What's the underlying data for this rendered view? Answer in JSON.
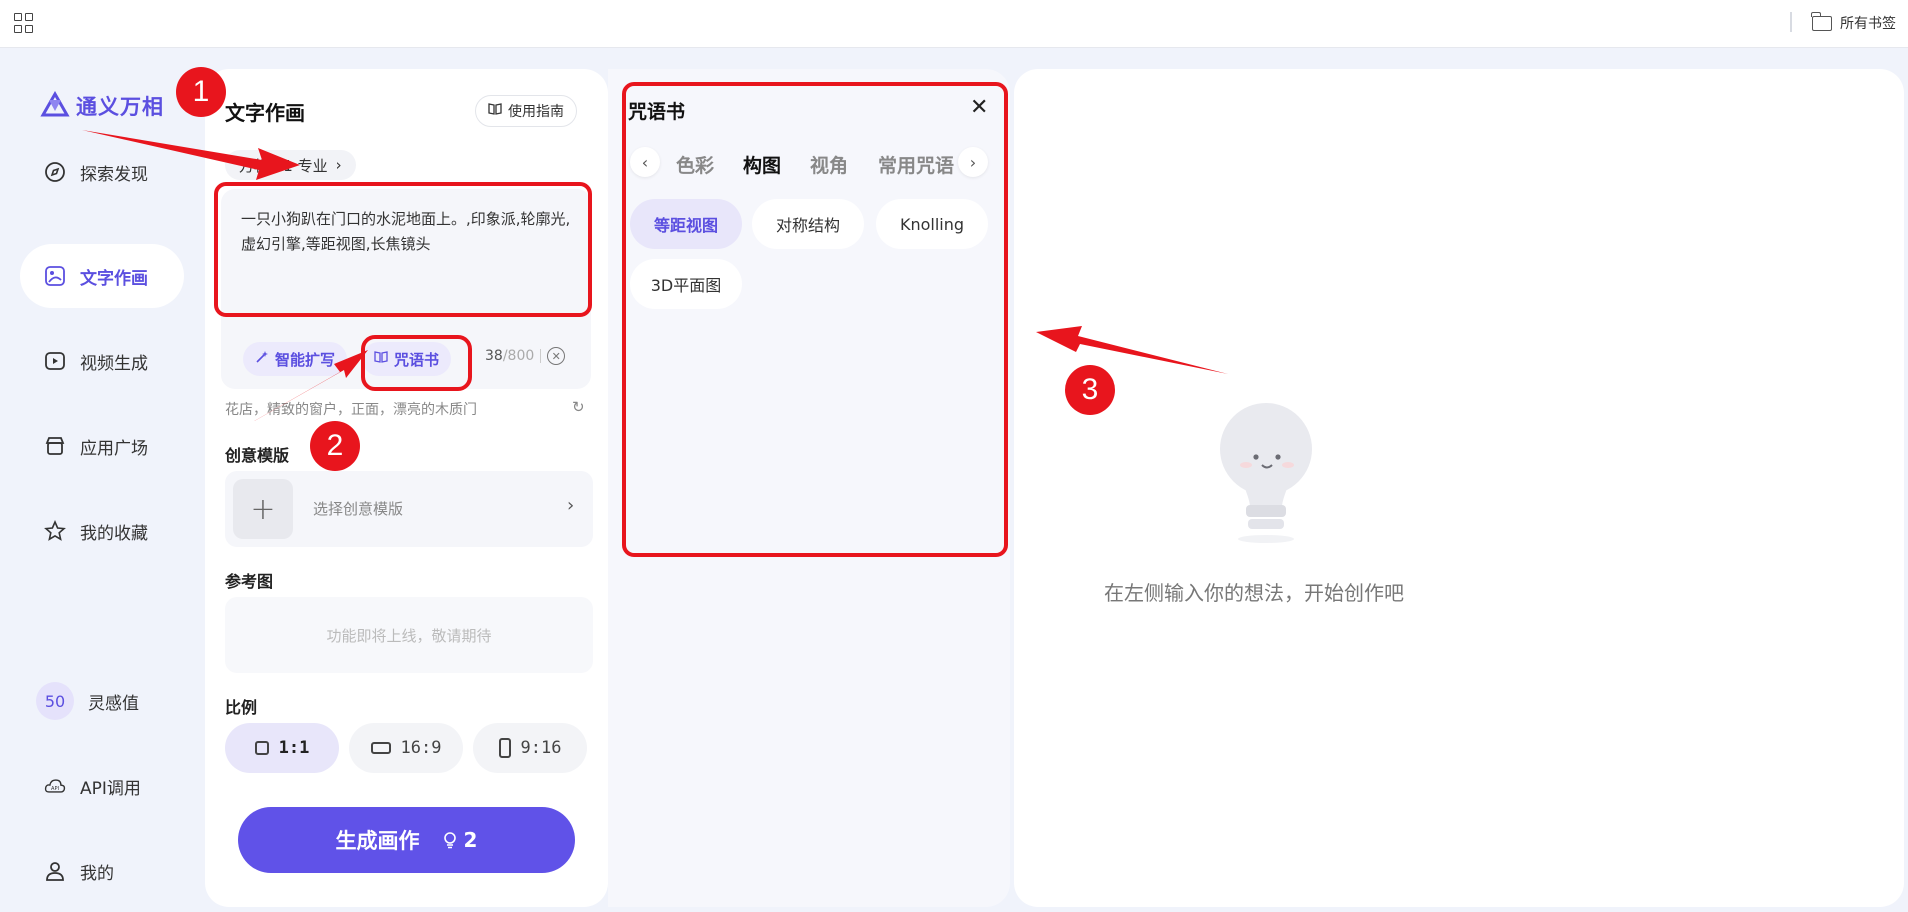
{
  "topbar": {
    "bookmarks_label": "所有书签"
  },
  "sidebar": {
    "logo_text": "通义万相",
    "items": [
      {
        "label": "探索发现",
        "icon": "compass-icon"
      },
      {
        "label": "文字作画",
        "icon": "image-icon"
      },
      {
        "label": "视频生成",
        "icon": "video-icon"
      },
      {
        "label": "应用广场",
        "icon": "store-icon"
      },
      {
        "label": "我的收藏",
        "icon": "star-icon"
      }
    ],
    "inspiration_value": "50",
    "inspiration_label": "灵感值",
    "api_label": "API调用",
    "me_label": "我的"
  },
  "form": {
    "title": "文字作画",
    "guide_label": "使用指南",
    "model_label": "万相2.1 专业",
    "prompt": "一只小狗趴在门口的水泥地面上。,印象派,轮廓光,虚幻引擎,等距视图,长焦镜头",
    "smart_expand_label": "智能扩写",
    "spellbook_label": "咒语书",
    "char_count": "38",
    "char_max": "/800",
    "suggestion": "花店，精致的窗户，正面，漂亮的木质门",
    "template_section": "创意模版",
    "template_placeholder": "选择创意模版",
    "reference_section": "参考图",
    "reference_placeholder": "功能即将上线，敬请期待",
    "ratio_section": "比例",
    "ratios": [
      "1:1",
      "16:9",
      "9:16"
    ],
    "generate_label": "生成画作",
    "generate_cost": "2"
  },
  "spellbook": {
    "title": "咒语书",
    "tabs": [
      "色彩",
      "构图",
      "视角",
      "常用咒语"
    ],
    "active_tab": "构图",
    "chips": [
      "等距视图",
      "对称结构",
      "Knolling",
      "3D平面图"
    ],
    "active_chip": "等距视图"
  },
  "canvas": {
    "empty_text": "在左侧输入你的想法，开始创作吧"
  },
  "annotations": {
    "badges": [
      "1",
      "2",
      "3"
    ],
    "color": "#e8151d"
  },
  "colors": {
    "accent": "#5b4fe0",
    "button": "#6052e8"
  }
}
